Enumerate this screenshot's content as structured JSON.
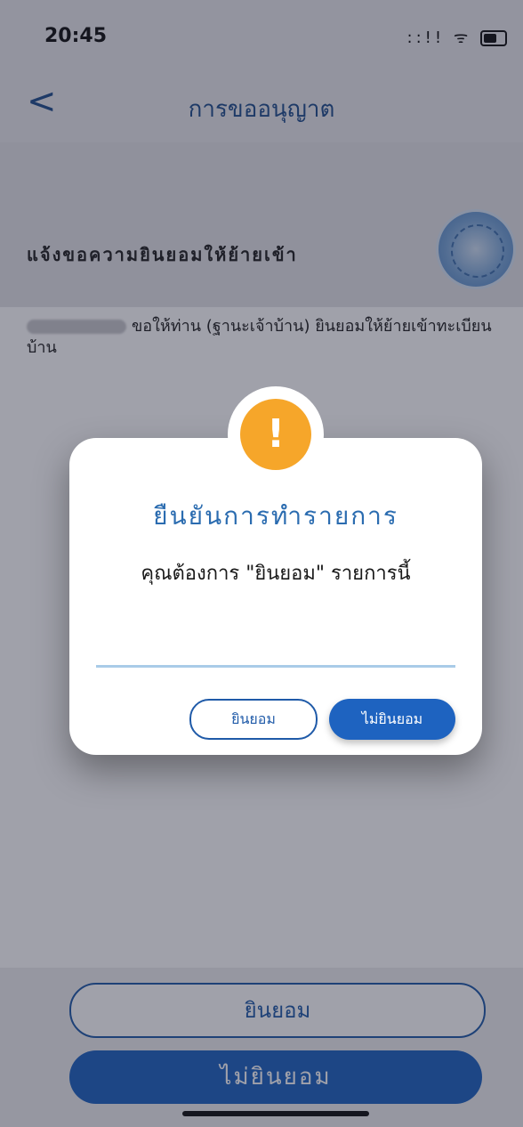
{
  "status_bar": {
    "time": "20:45",
    "signal": "::!!",
    "wifi": "ᯤ"
  },
  "navbar": {
    "back_symbol": "<",
    "title": "การขออนุญาต"
  },
  "header": {
    "section_title": "แจ้งขอความยินยอมให้ย้ายเข้า"
  },
  "content": {
    "body_text": "ขอให้ท่าน (ฐานะเจ้าบ้าน) ยินยอมให้ย้ายเข้าทะเบียนบ้าน"
  },
  "bottom_bar": {
    "consent_label": "ยินยอม",
    "decline_label": "ไม่ยินยอม"
  },
  "dialog": {
    "alert_symbol": "!",
    "title": "ยืนยันการทำรายการ",
    "message": "คุณต้องการ \"ยินยอม\" รายการนี้",
    "consent_label": "ยินยอม",
    "decline_label": "ไม่ยินยอม"
  },
  "colors": {
    "accent": "#1e63c0",
    "warning": "#f6a62a",
    "title_blue": "#2b6cb0"
  }
}
